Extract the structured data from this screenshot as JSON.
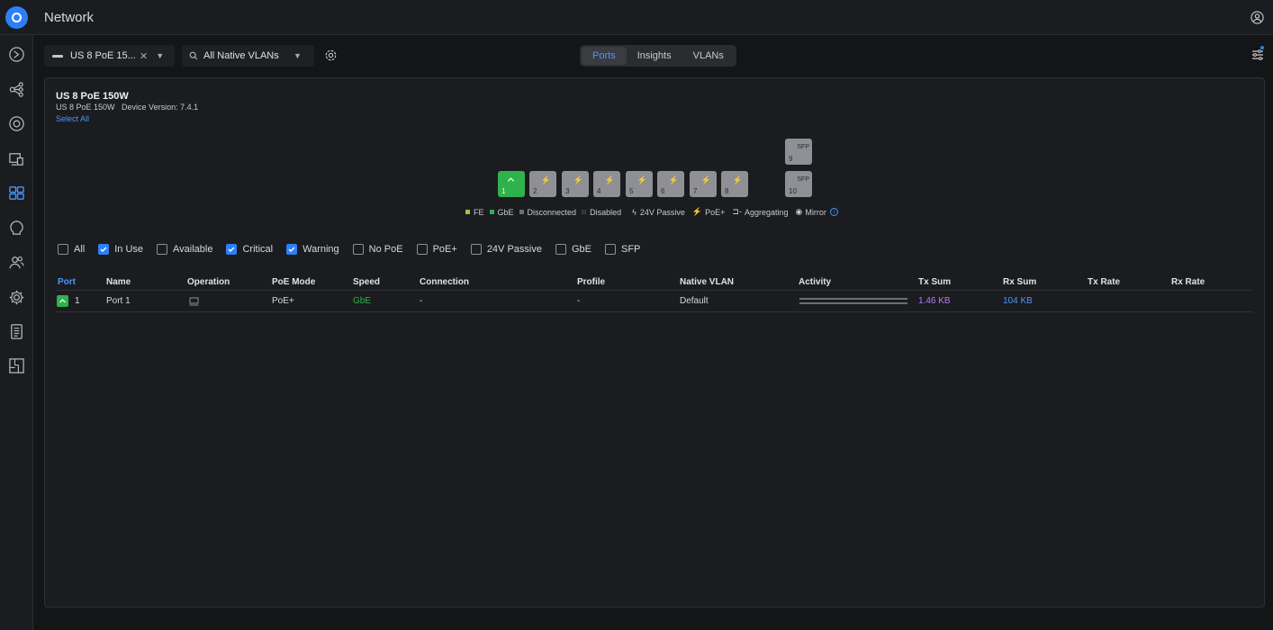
{
  "app": {
    "title": "Network"
  },
  "toolbar": {
    "device_select": "US 8 PoE 15...",
    "vlan_select": "All Native VLANs",
    "tabs": [
      {
        "label": "Ports",
        "active": true
      },
      {
        "label": "Insights",
        "active": false
      },
      {
        "label": "VLANs",
        "active": false
      }
    ]
  },
  "device": {
    "title": "US 8 PoE 150W",
    "model": "US 8 PoE 150W",
    "version": "Device Version: 7.4.1",
    "select_all": "Select All"
  },
  "ports_panel": {
    "ports": [
      {
        "number": "1",
        "state": "active-gbe",
        "icon": "uplink-icon"
      },
      {
        "number": "2",
        "state": "disconnected",
        "icon": "poe-bolt-icon"
      },
      {
        "number": "3",
        "state": "disconnected",
        "icon": "poe-bolt-icon"
      },
      {
        "number": "4",
        "state": "disconnected",
        "icon": "poe-bolt-icon"
      },
      {
        "number": "5",
        "state": "disconnected",
        "icon": "poe-bolt-icon"
      },
      {
        "number": "6",
        "state": "disconnected",
        "icon": "poe-bolt-icon"
      },
      {
        "number": "7",
        "state": "disconnected",
        "icon": "poe-bolt-icon"
      },
      {
        "number": "8",
        "state": "disconnected",
        "icon": "poe-bolt-icon"
      }
    ],
    "sfp_ports": [
      {
        "number": "9",
        "label": "SFP"
      },
      {
        "number": "10",
        "label": "SFP"
      }
    ],
    "legend": [
      {
        "label": "FE",
        "color": "#9bc53d"
      },
      {
        "label": "GbE",
        "color": "#2fb24d"
      },
      {
        "label": "Disconnected",
        "color": "#6c6e73"
      },
      {
        "label": "Disabled",
        "color": "#2a2c30"
      },
      {
        "label": "24V Passive",
        "icon": "bolt-icon"
      },
      {
        "label": "PoE+",
        "icon": "poe-plus-icon"
      },
      {
        "label": "Aggregating",
        "icon": "aggregate-icon"
      },
      {
        "label": "Mirror",
        "icon": "eye-icon"
      }
    ]
  },
  "filters": [
    {
      "label": "All",
      "checked": false
    },
    {
      "label": "In Use",
      "checked": true
    },
    {
      "label": "Available",
      "checked": false
    },
    {
      "label": "Critical",
      "checked": true
    },
    {
      "label": "Warning",
      "checked": true
    },
    {
      "label": "No PoE",
      "checked": false
    },
    {
      "label": "PoE+",
      "checked": false
    },
    {
      "label": "24V Passive",
      "checked": false
    },
    {
      "label": "GbE",
      "checked": false
    },
    {
      "label": "SFP",
      "checked": false
    }
  ],
  "table": {
    "headers": {
      "port": "Port",
      "name": "Name",
      "operation": "Operation",
      "poe_mode": "PoE Mode",
      "speed": "Speed",
      "connection": "Connection",
      "profile": "Profile",
      "native_vlan": "Native VLAN",
      "activity": "Activity",
      "tx_sum": "Tx Sum",
      "rx_sum": "Rx Sum",
      "tx_rate": "Tx Rate",
      "rx_rate": "Rx Rate"
    },
    "rows": [
      {
        "port": "1",
        "name": "Port 1",
        "poe_mode": "PoE+",
        "speed": "GbE",
        "connection": "-",
        "profile": "-",
        "native_vlan": "Default",
        "tx_sum": "1.46 KB",
        "rx_sum": "104 KB"
      }
    ]
  },
  "colors": {
    "accent": "#2d7ff9",
    "link": "#4797ff",
    "green": "#2fb24d",
    "tx": "#b57cf2",
    "rx": "#4797ff"
  }
}
